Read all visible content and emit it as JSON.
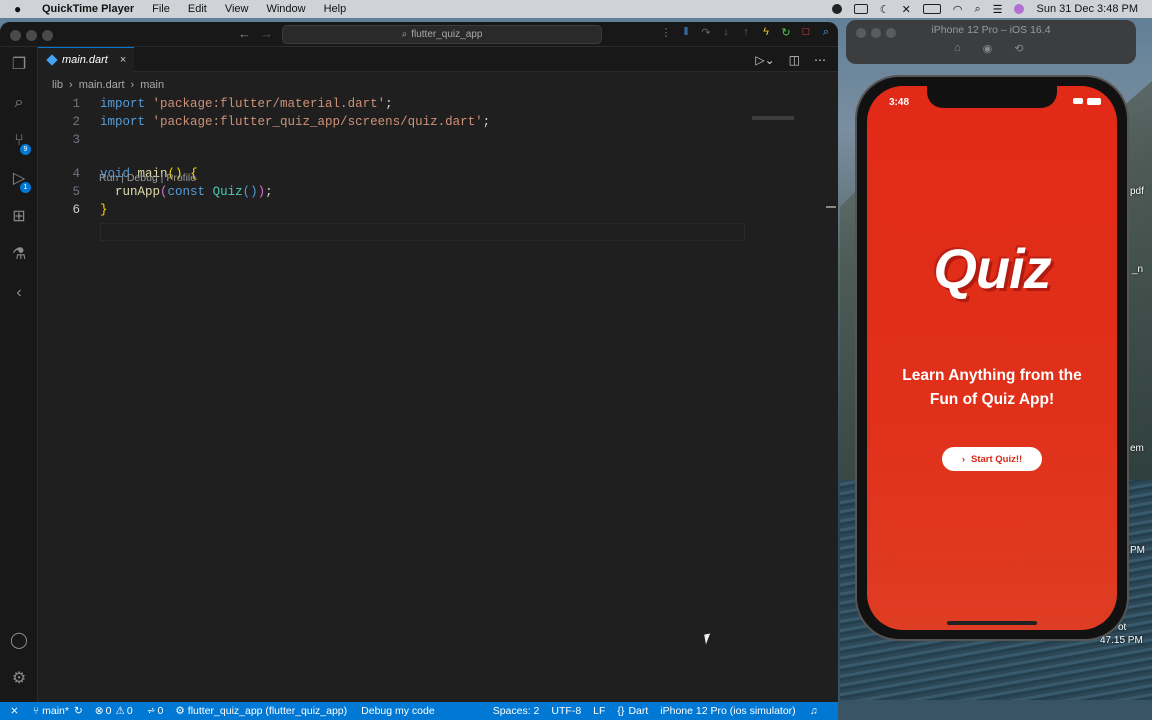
{
  "menubar": {
    "app": "QuickTime Player",
    "items": [
      "File",
      "Edit",
      "View",
      "Window",
      "Help"
    ],
    "datetime": "Sun 31 Dec  3:48 PM"
  },
  "editor": {
    "search": "flutter_quiz_app",
    "tab": {
      "label": "main.dart",
      "close": "×"
    },
    "breadcrumb": {
      "folder": "lib",
      "file": "main.dart",
      "symbol": "main"
    },
    "activity_badges": {
      "source_control": "9",
      "run_debug": "1"
    },
    "codelens": "Run | Debug | Profile",
    "lines": [
      {
        "num": "1"
      },
      {
        "num": "2"
      },
      {
        "num": "3"
      },
      {
        "num": "4"
      },
      {
        "num": "5"
      },
      {
        "num": "6"
      }
    ],
    "code": {
      "l1_kw": "import",
      "l1_str": "'package:flutter/material.dart'",
      "l1_end": ";",
      "l2_kw": "import",
      "l2_str": "'package:flutter_quiz_app/screens/quiz.dart'",
      "l2_end": ";",
      "l4_kw": "void",
      "l4_fn": "main",
      "l4_paren": "()",
      "l4_brace": "{",
      "l5_fn": "runApp",
      "l5_open": "(",
      "l5_kw": "const",
      "l5_cls": "Quiz",
      "l5_inner": "()",
      "l5_close": ")",
      "l5_end": ";",
      "l6_brace": "}"
    }
  },
  "statusbar": {
    "remote": "⨯",
    "branch": "main*",
    "errors": "0",
    "warnings": "0",
    "ports": "0",
    "target": "flutter_quiz_app (flutter_quiz_app)",
    "debug": "Debug my code",
    "spaces": "Spaces: 2",
    "encoding": "UTF-8",
    "eol": "LF",
    "language": "Dart",
    "device": "iPhone 12 Pro (ios simulator)"
  },
  "simulator": {
    "title": "iPhone 12 Pro – iOS 16.4",
    "time": "3:48",
    "logo": "Quiz",
    "tagline": "Learn Anything from the Fun of Quiz App!",
    "button": "Start Quiz!!",
    "background_color": "#e12a17"
  },
  "desktop_labels": [
    "pdf",
    "_n",
    "em",
    "PM",
    "ot",
    "47.15 PM"
  ]
}
